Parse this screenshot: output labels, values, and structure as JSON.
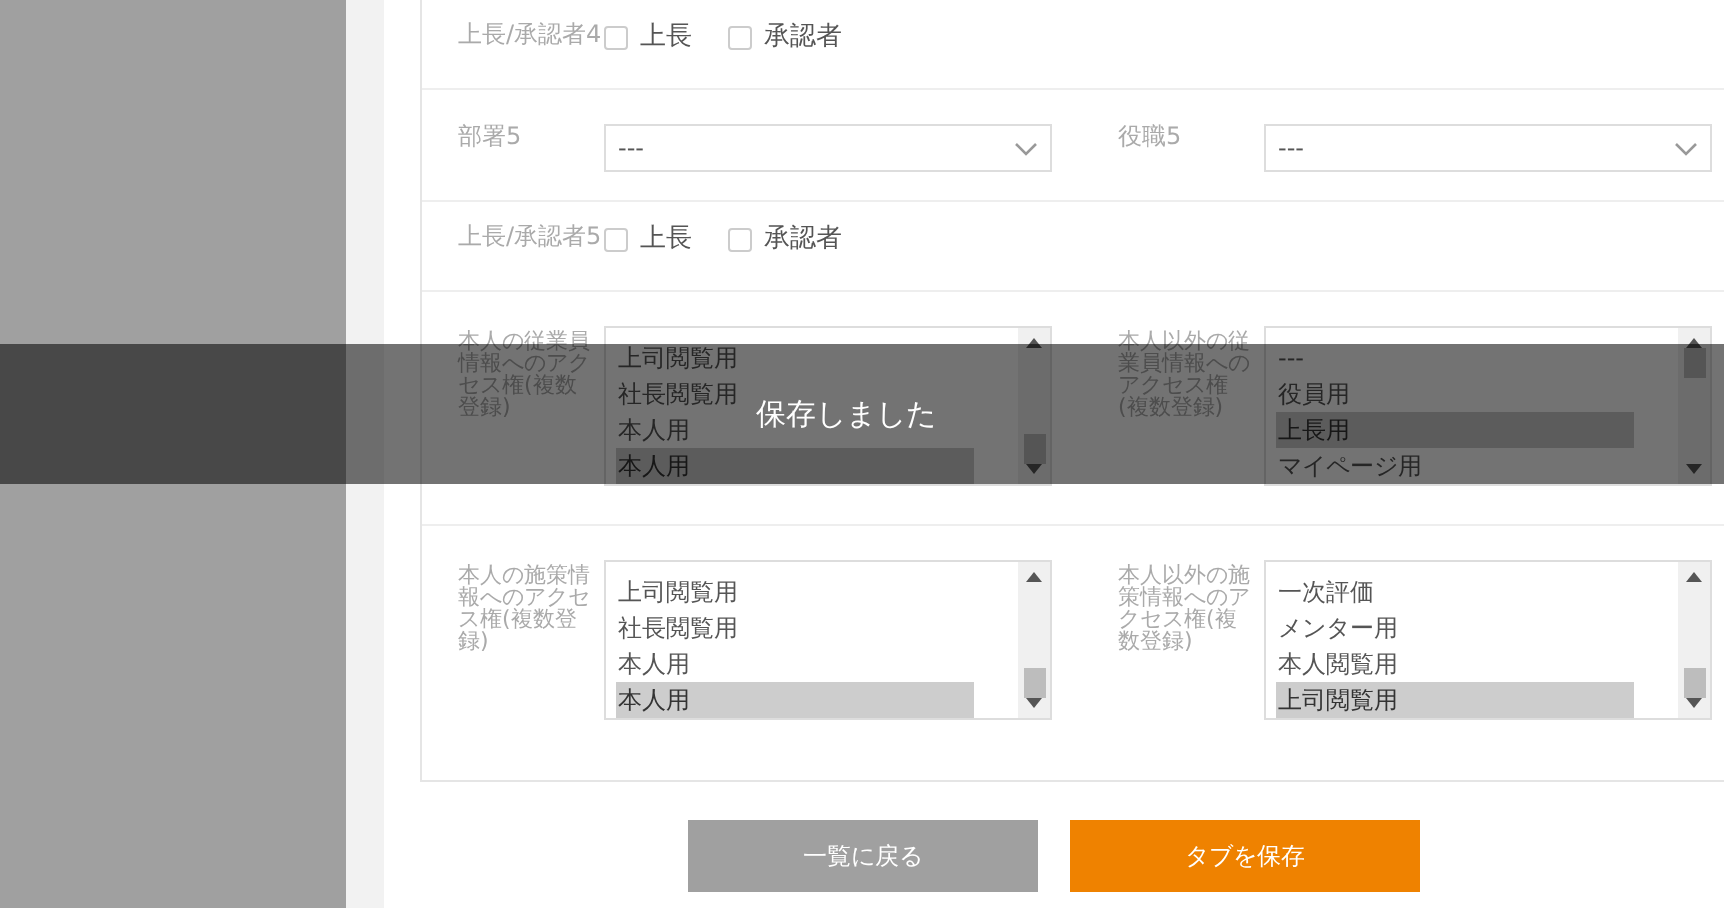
{
  "rows": [
    {
      "kind": "checks",
      "label": "上長/承認者4",
      "options": [
        {
          "label": "上長",
          "checked": false
        },
        {
          "label": "承認者",
          "checked": false
        }
      ]
    },
    {
      "kind": "selects",
      "fields": [
        {
          "label": "部署5",
          "value": "---"
        },
        {
          "label": "役職5",
          "value": "---"
        }
      ]
    },
    {
      "kind": "checks",
      "label": "上長/承認者5",
      "options": [
        {
          "label": "上長",
          "checked": false
        },
        {
          "label": "承認者",
          "checked": false
        }
      ]
    },
    {
      "kind": "lists",
      "fields": [
        {
          "label": "本人の従業員情報へのアクセス権(複数登録)",
          "items": [
            {
              "label": "上司閲覧用",
              "selected": false
            },
            {
              "label": "社長閲覧用",
              "selected": false
            },
            {
              "label": "本人用",
              "selected": false
            },
            {
              "label": "本人用",
              "selected": true
            }
          ]
        },
        {
          "label": "本人以外の従業員情報へのアクセス権(複数登録)",
          "items": [
            {
              "label": "---",
              "selected": false
            },
            {
              "label": "役員用",
              "selected": false
            },
            {
              "label": "上長用",
              "selected": true
            },
            {
              "label": "マイページ用",
              "selected": false
            }
          ]
        }
      ]
    },
    {
      "kind": "lists",
      "fields": [
        {
          "label": "本人の施策情報へのアクセス権(複数登録)",
          "items": [
            {
              "label": "上司閲覧用",
              "selected": false
            },
            {
              "label": "社長閲覧用",
              "selected": false
            },
            {
              "label": "本人用",
              "selected": false
            },
            {
              "label": "本人用",
              "selected": true
            }
          ]
        },
        {
          "label": "本人以外の施策情報へのアクセス権(複数登録)",
          "items": [
            {
              "label": "一次評価",
              "selected": false
            },
            {
              "label": "メンター用",
              "selected": false
            },
            {
              "label": "本人閲覧用",
              "selected": false
            },
            {
              "label": "上司閲覧用",
              "selected": true
            }
          ]
        }
      ]
    }
  ],
  "buttons": [
    {
      "label": "一覧に戻る",
      "kind": "secondary"
    },
    {
      "label": "タブを保存",
      "kind": "primary"
    }
  ],
  "toast": {
    "message": "保存しました"
  }
}
